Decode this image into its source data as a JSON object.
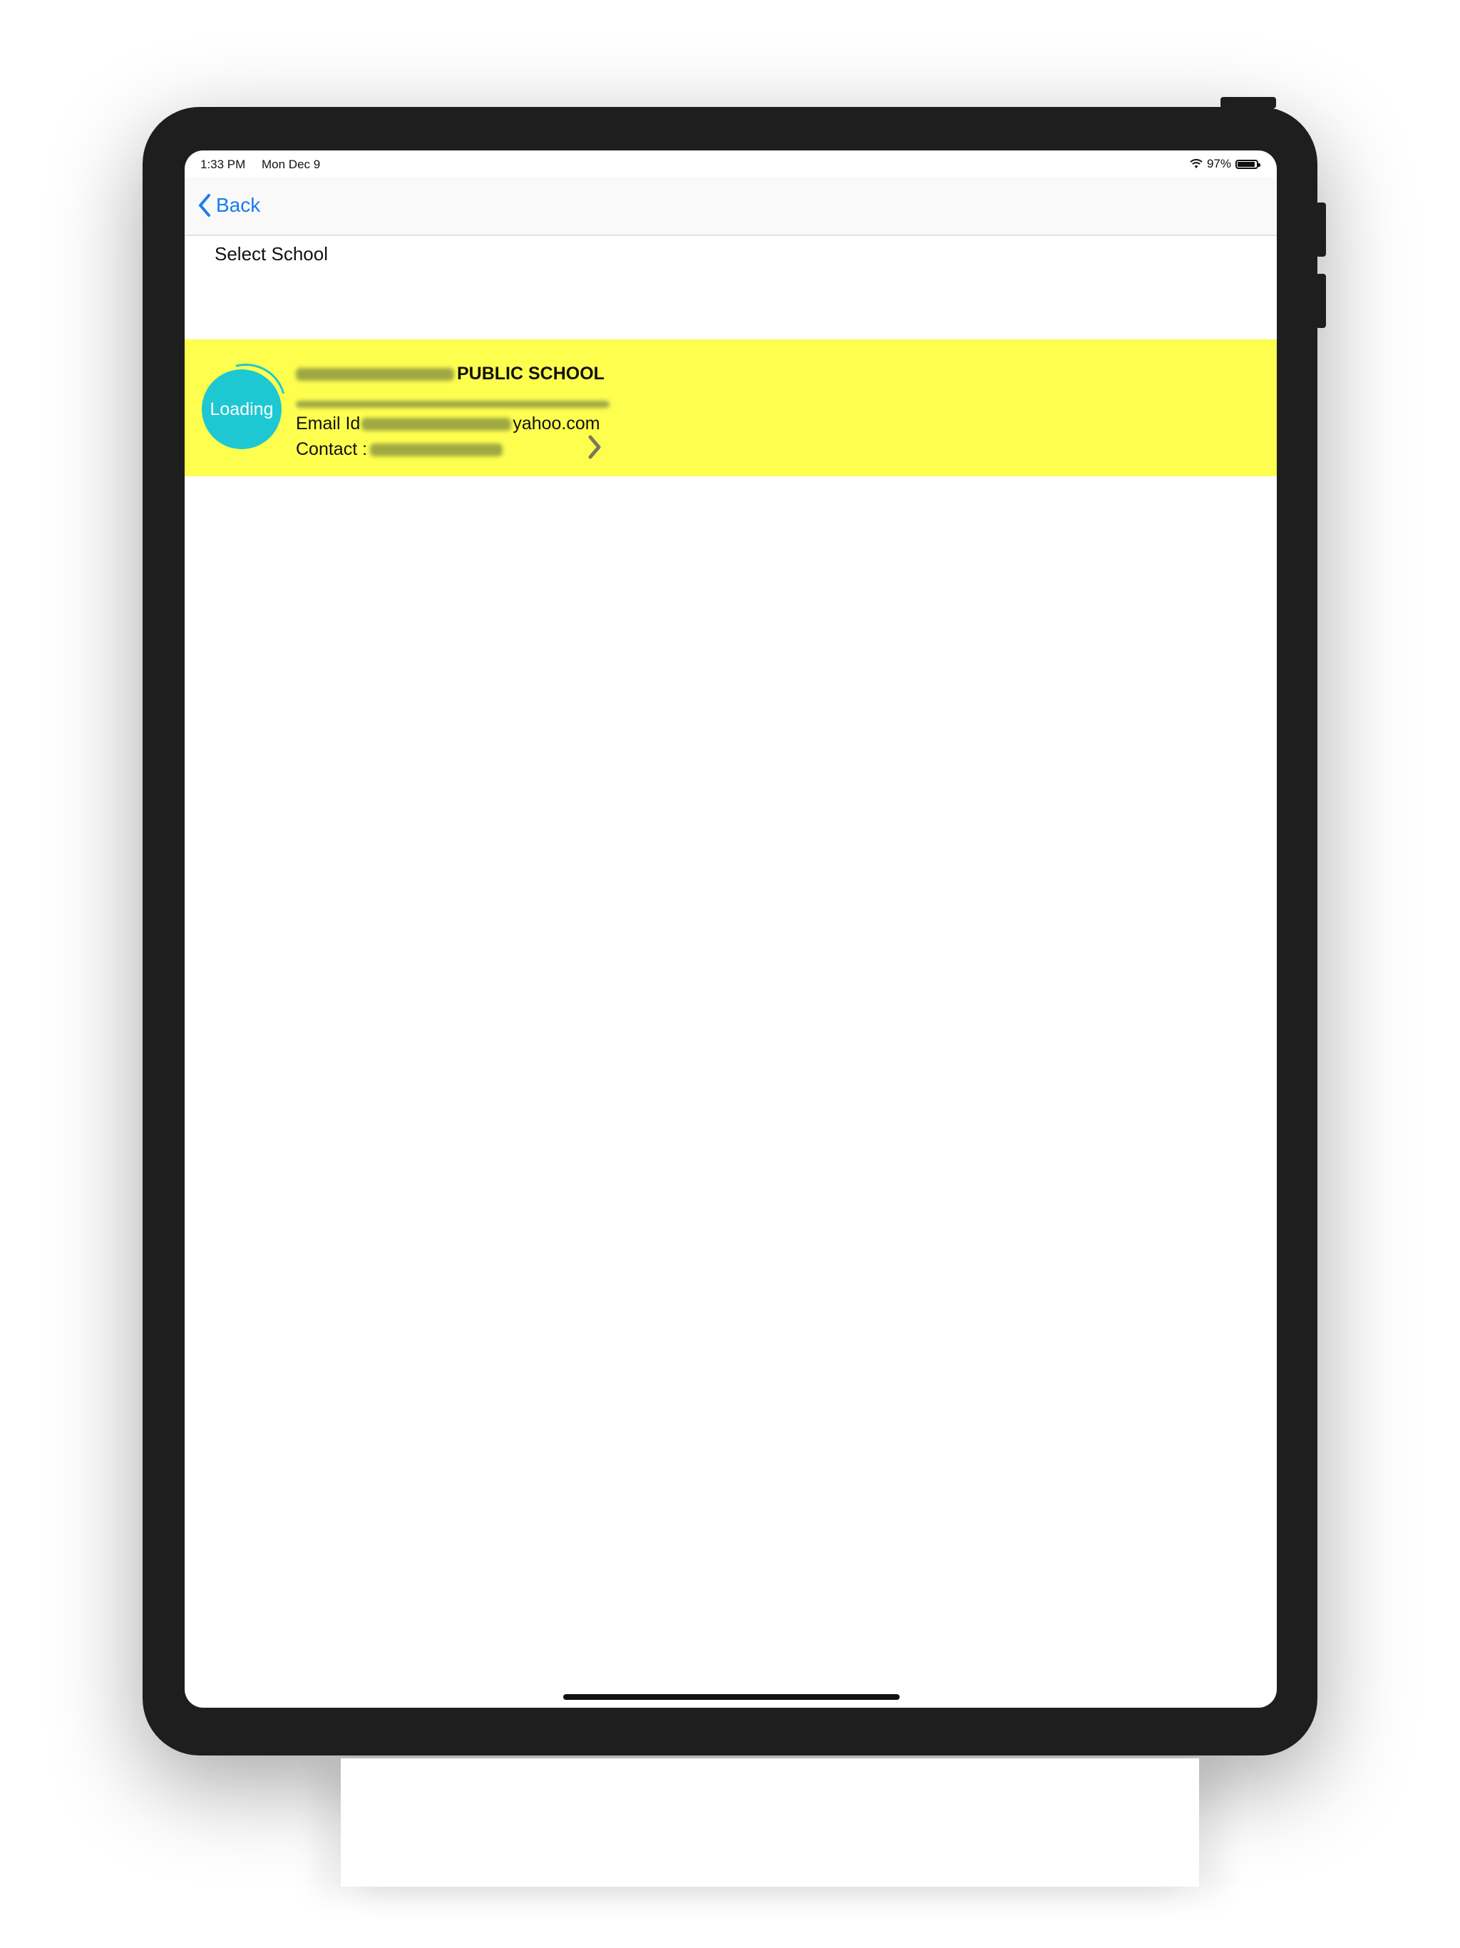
{
  "status_bar": {
    "time": "1:33 PM",
    "date": "Mon Dec 9",
    "battery": "97%"
  },
  "nav": {
    "back_label": "Back"
  },
  "section": {
    "title": "Select School"
  },
  "school": {
    "name_suffix": "PUBLIC SCHOOL",
    "email_prefix": "Email Id",
    "email_suffix": "yahoo.com",
    "contact_label": "Contact :",
    "logo_text": "Loading"
  },
  "colors": {
    "row_highlight": "#fefe4f",
    "accent": "#1a7cf0",
    "logo_bg": "#1ec8d2"
  }
}
